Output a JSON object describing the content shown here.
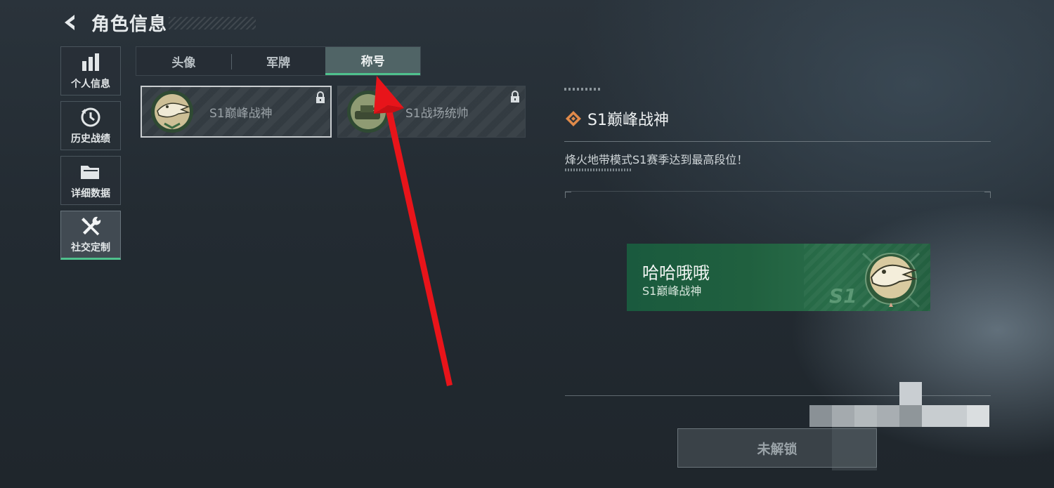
{
  "header": {
    "title": "角色信息",
    "back_icon": "chevron-left-icon"
  },
  "sidebar": {
    "items": [
      {
        "label": "个人信息",
        "icon": "bar-chart-icon",
        "active": false
      },
      {
        "label": "历史战绩",
        "icon": "history-clock-icon",
        "active": false
      },
      {
        "label": "详细数据",
        "icon": "folder-icon",
        "active": false
      },
      {
        "label": "社交定制",
        "icon": "tools-icon",
        "active": true
      }
    ]
  },
  "tabs": [
    {
      "label": "头像",
      "active": false
    },
    {
      "label": "军牌",
      "active": false
    },
    {
      "label": "称号",
      "active": true
    }
  ],
  "titles": [
    {
      "label": "S1巅峰战神",
      "icon": "crocodile-emblem-icon",
      "selected": true,
      "locked": true
    },
    {
      "label": "S1战场统帅",
      "icon": "tank-emblem-icon",
      "selected": false,
      "locked": true
    }
  ],
  "detail": {
    "title": "S1巅峰战神",
    "description": "烽火地带模式S1赛季达到最高段位！",
    "preview": {
      "player_name": "哈哈哦哦",
      "title_text": "S1巅峰战神",
      "season_mark": "S1"
    },
    "unlock_button": "未解锁"
  },
  "colors": {
    "accent": "#4fc18d",
    "banner_green": "#20603f",
    "annotation_red": "#e8141a",
    "diamond": "#e08a4a"
  }
}
